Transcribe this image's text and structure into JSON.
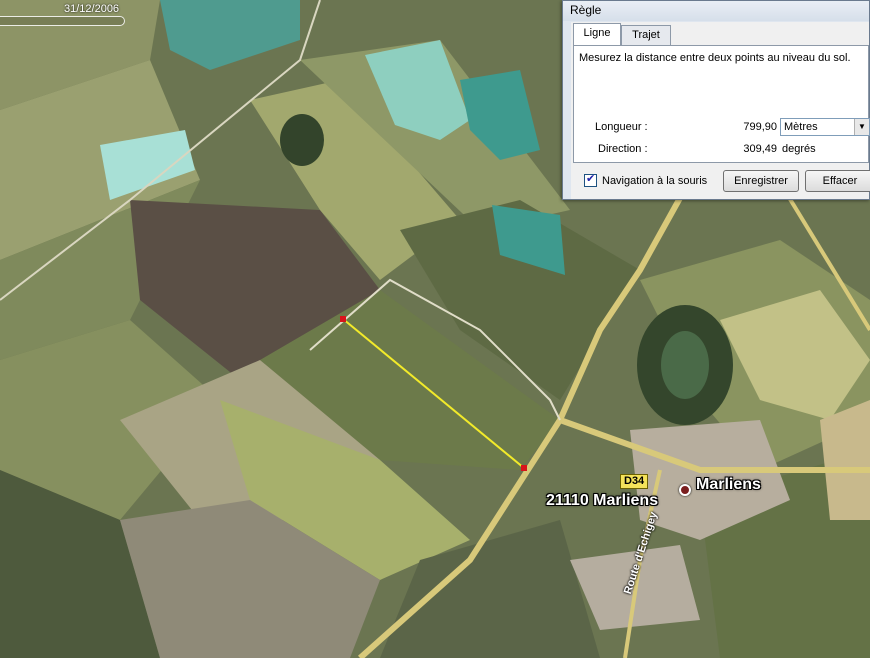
{
  "map": {
    "date_label": "31/12/2006",
    "road_shield": "D34",
    "place_postcode_label": "21110 Marliens",
    "place_label": "Marliens",
    "road_name_vertical": "Route d'Echigey",
    "measure_line_color": "#f2ea2a",
    "measure_endpoint_color": "#d8141b"
  },
  "dialog": {
    "title": "Règle",
    "tabs": [
      {
        "label": "Ligne",
        "active": true
      },
      {
        "label": "Trajet",
        "active": false
      }
    ],
    "description": "Mesurez la distance entre deux points au niveau du sol.",
    "length_label": "Longueur :",
    "length_value": "799,90",
    "unit_selected": "Mètres",
    "direction_label": "Direction :",
    "direction_value": "309,49",
    "direction_unit": "degrés",
    "mouse_nav_label": "Navigation à la souris",
    "mouse_nav_checked": true,
    "save_button": "Enregistrer",
    "clear_button": "Effacer"
  }
}
